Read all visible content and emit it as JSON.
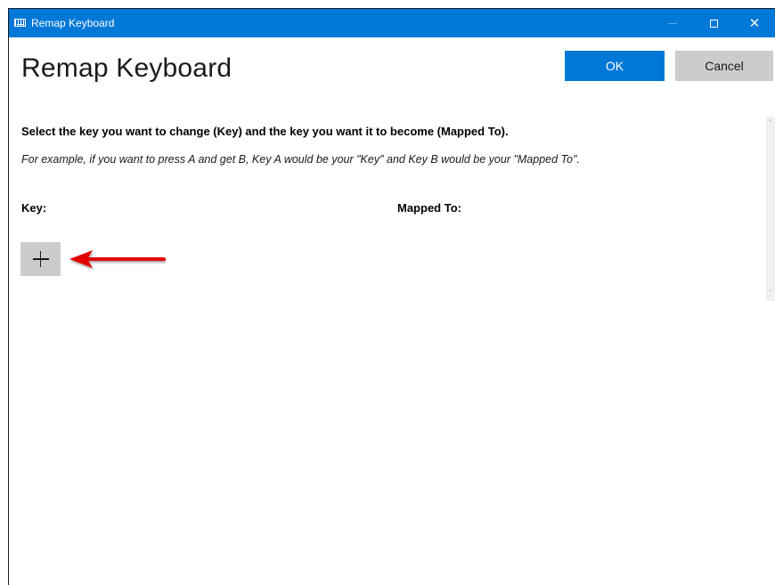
{
  "window": {
    "title": "Remap Keyboard",
    "controls": {
      "minimize": "—",
      "maximize": "□",
      "close": "✕"
    }
  },
  "header": {
    "title": "Remap Keyboard",
    "ok_label": "OK",
    "cancel_label": "Cancel"
  },
  "content": {
    "instruction": "Select the key you want to change (Key) and the key you want it to become (Mapped To).",
    "example": "For example, if you want to press A and get B, Key A would be your \"Key\" and Key B would be your \"Mapped To\".",
    "column_key": "Key:",
    "column_mapped": "Mapped To:"
  },
  "icons": {
    "app": "keyboard-icon",
    "add": "plus-icon",
    "annotation": "red-arrow-icon"
  },
  "colors": {
    "accent": "#0078d7",
    "annotation": "#e00000"
  }
}
